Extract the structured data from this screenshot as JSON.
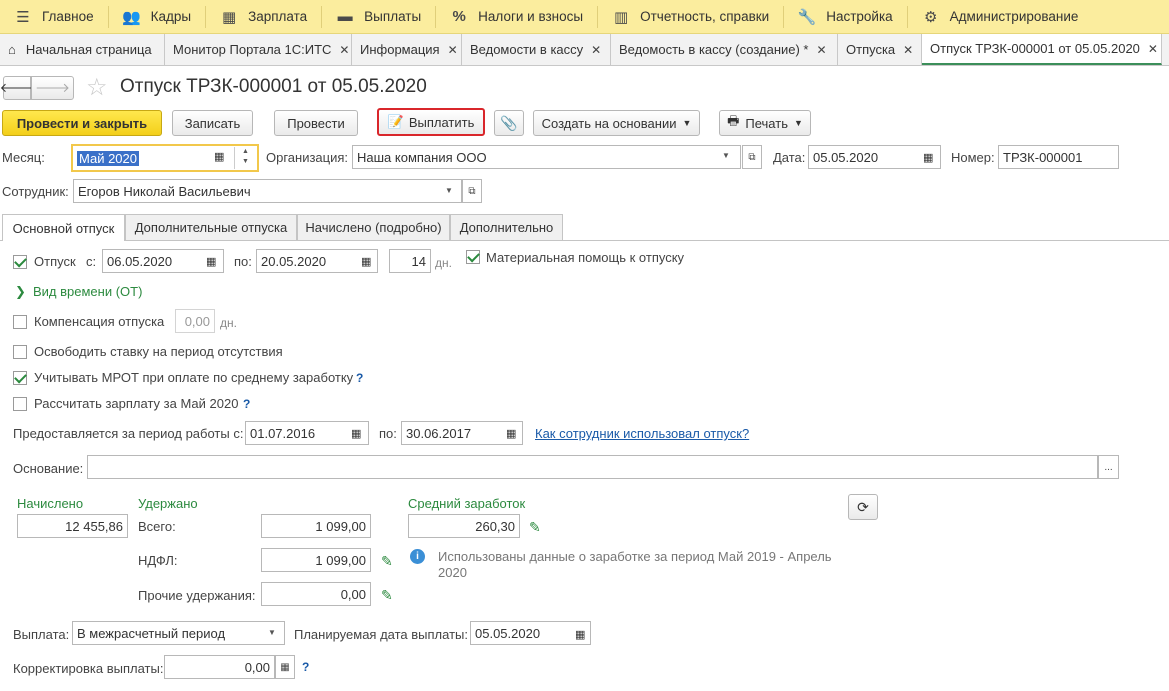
{
  "menu": [
    {
      "label": "Главное",
      "icon": "menu-icon"
    },
    {
      "label": "Кадры",
      "icon": "people-icon"
    },
    {
      "label": "Зарплата",
      "icon": "calculator-icon"
    },
    {
      "label": "Выплаты",
      "icon": "wallet-icon"
    },
    {
      "label": "Налоги и взносы",
      "icon": "percent-icon"
    },
    {
      "label": "Отчетность, справки",
      "icon": "report-icon"
    },
    {
      "label": "Настройка",
      "icon": "wrench-icon"
    },
    {
      "label": "Администрирование",
      "icon": "gear-icon"
    }
  ],
  "tabs": [
    {
      "label": "Начальная страница",
      "closable": false
    },
    {
      "label": "Монитор Портала 1С:ИТС",
      "closable": true
    },
    {
      "label": "Информация",
      "closable": true
    },
    {
      "label": "Ведомости в кассу",
      "closable": true
    },
    {
      "label": "Ведомость в кассу (создание) *",
      "closable": true
    },
    {
      "label": "Отпуска",
      "closable": true
    },
    {
      "label": "Отпуск ТРЗК-000001 от 05.05.2020",
      "closable": true
    }
  ],
  "header": {
    "title": "Отпуск ТРЗК-000001 от 05.05.2020"
  },
  "toolbar": {
    "post_close": "Провести и закрыть",
    "save": "Записать",
    "post": "Провести",
    "pay": "Выплатить",
    "create_based": "Создать на основании",
    "print": "Печать"
  },
  "form": {
    "month_label": "Месяц:",
    "month_value": "Май 2020",
    "org_label": "Организация:",
    "org_value": "Наша компания ООО",
    "date_label": "Дата:",
    "date_value": "05.05.2020",
    "number_label": "Номер:",
    "number_value": "ТРЗК-000001",
    "employee_label": "Сотрудник:",
    "employee_value": "Егоров Николай Васильевич"
  },
  "form_tabs": [
    "Основной отпуск",
    "Дополнительные отпуска",
    "Начислено (подробно)",
    "Дополнительно"
  ],
  "main": {
    "vacation_label": "Отпуск",
    "from_label": "с:",
    "from_value": "06.05.2020",
    "to_label": "по:",
    "to_value": "20.05.2020",
    "days_value": "14",
    "days_unit": "дн.",
    "material_help": "Материальная помощь к отпуску",
    "time_kind": "Вид времени (ОТ)",
    "compensation_label": "Компенсация отпуска",
    "compensation_value": "0,00",
    "compensation_unit": "дн.",
    "free_rate": "Освободить ставку на период отсутствия",
    "mrot": "Учитывать МРОТ при оплате по среднему заработку",
    "calc_salary": "Рассчитать зарплату за Май 2020",
    "period_label": "Предоставляется за период работы с:",
    "period_from": "01.07.2016",
    "period_to_label": "по:",
    "period_to": "30.06.2017",
    "how_used_link": "Как сотрудник использовал отпуск?",
    "basis_label": "Основание:",
    "basis_value": "",
    "accrued_label": "Начислено",
    "accrued_value": "12 455,86",
    "withheld_label": "Удержано",
    "total_label": "Всего:",
    "total_value": "1 099,00",
    "ndfl_label": "НДФЛ:",
    "ndfl_value": "1 099,00",
    "other_label": "Прочие удержания:",
    "other_value": "0,00",
    "avg_label": "Средний заработок",
    "avg_value": "260,30",
    "info_text_line1": "Использованы данные о заработке за период Май 2019 - Апрель",
    "info_text_line2": "2020",
    "payment_label": "Выплата:",
    "payment_value": "В межрасчетный период",
    "planned_label": "Планируемая дата выплаты:",
    "planned_value": "05.05.2020",
    "correction_label": "Корректировка выплаты:",
    "correction_value": "0,00"
  },
  "colors": {
    "menu_bg": "#fbed9e",
    "primary": "#f3cf1a",
    "active_tab": "#3c8f5a",
    "highlight": "#d9262b",
    "link": "#1a5aa8",
    "green_text": "#2c8a3f"
  }
}
